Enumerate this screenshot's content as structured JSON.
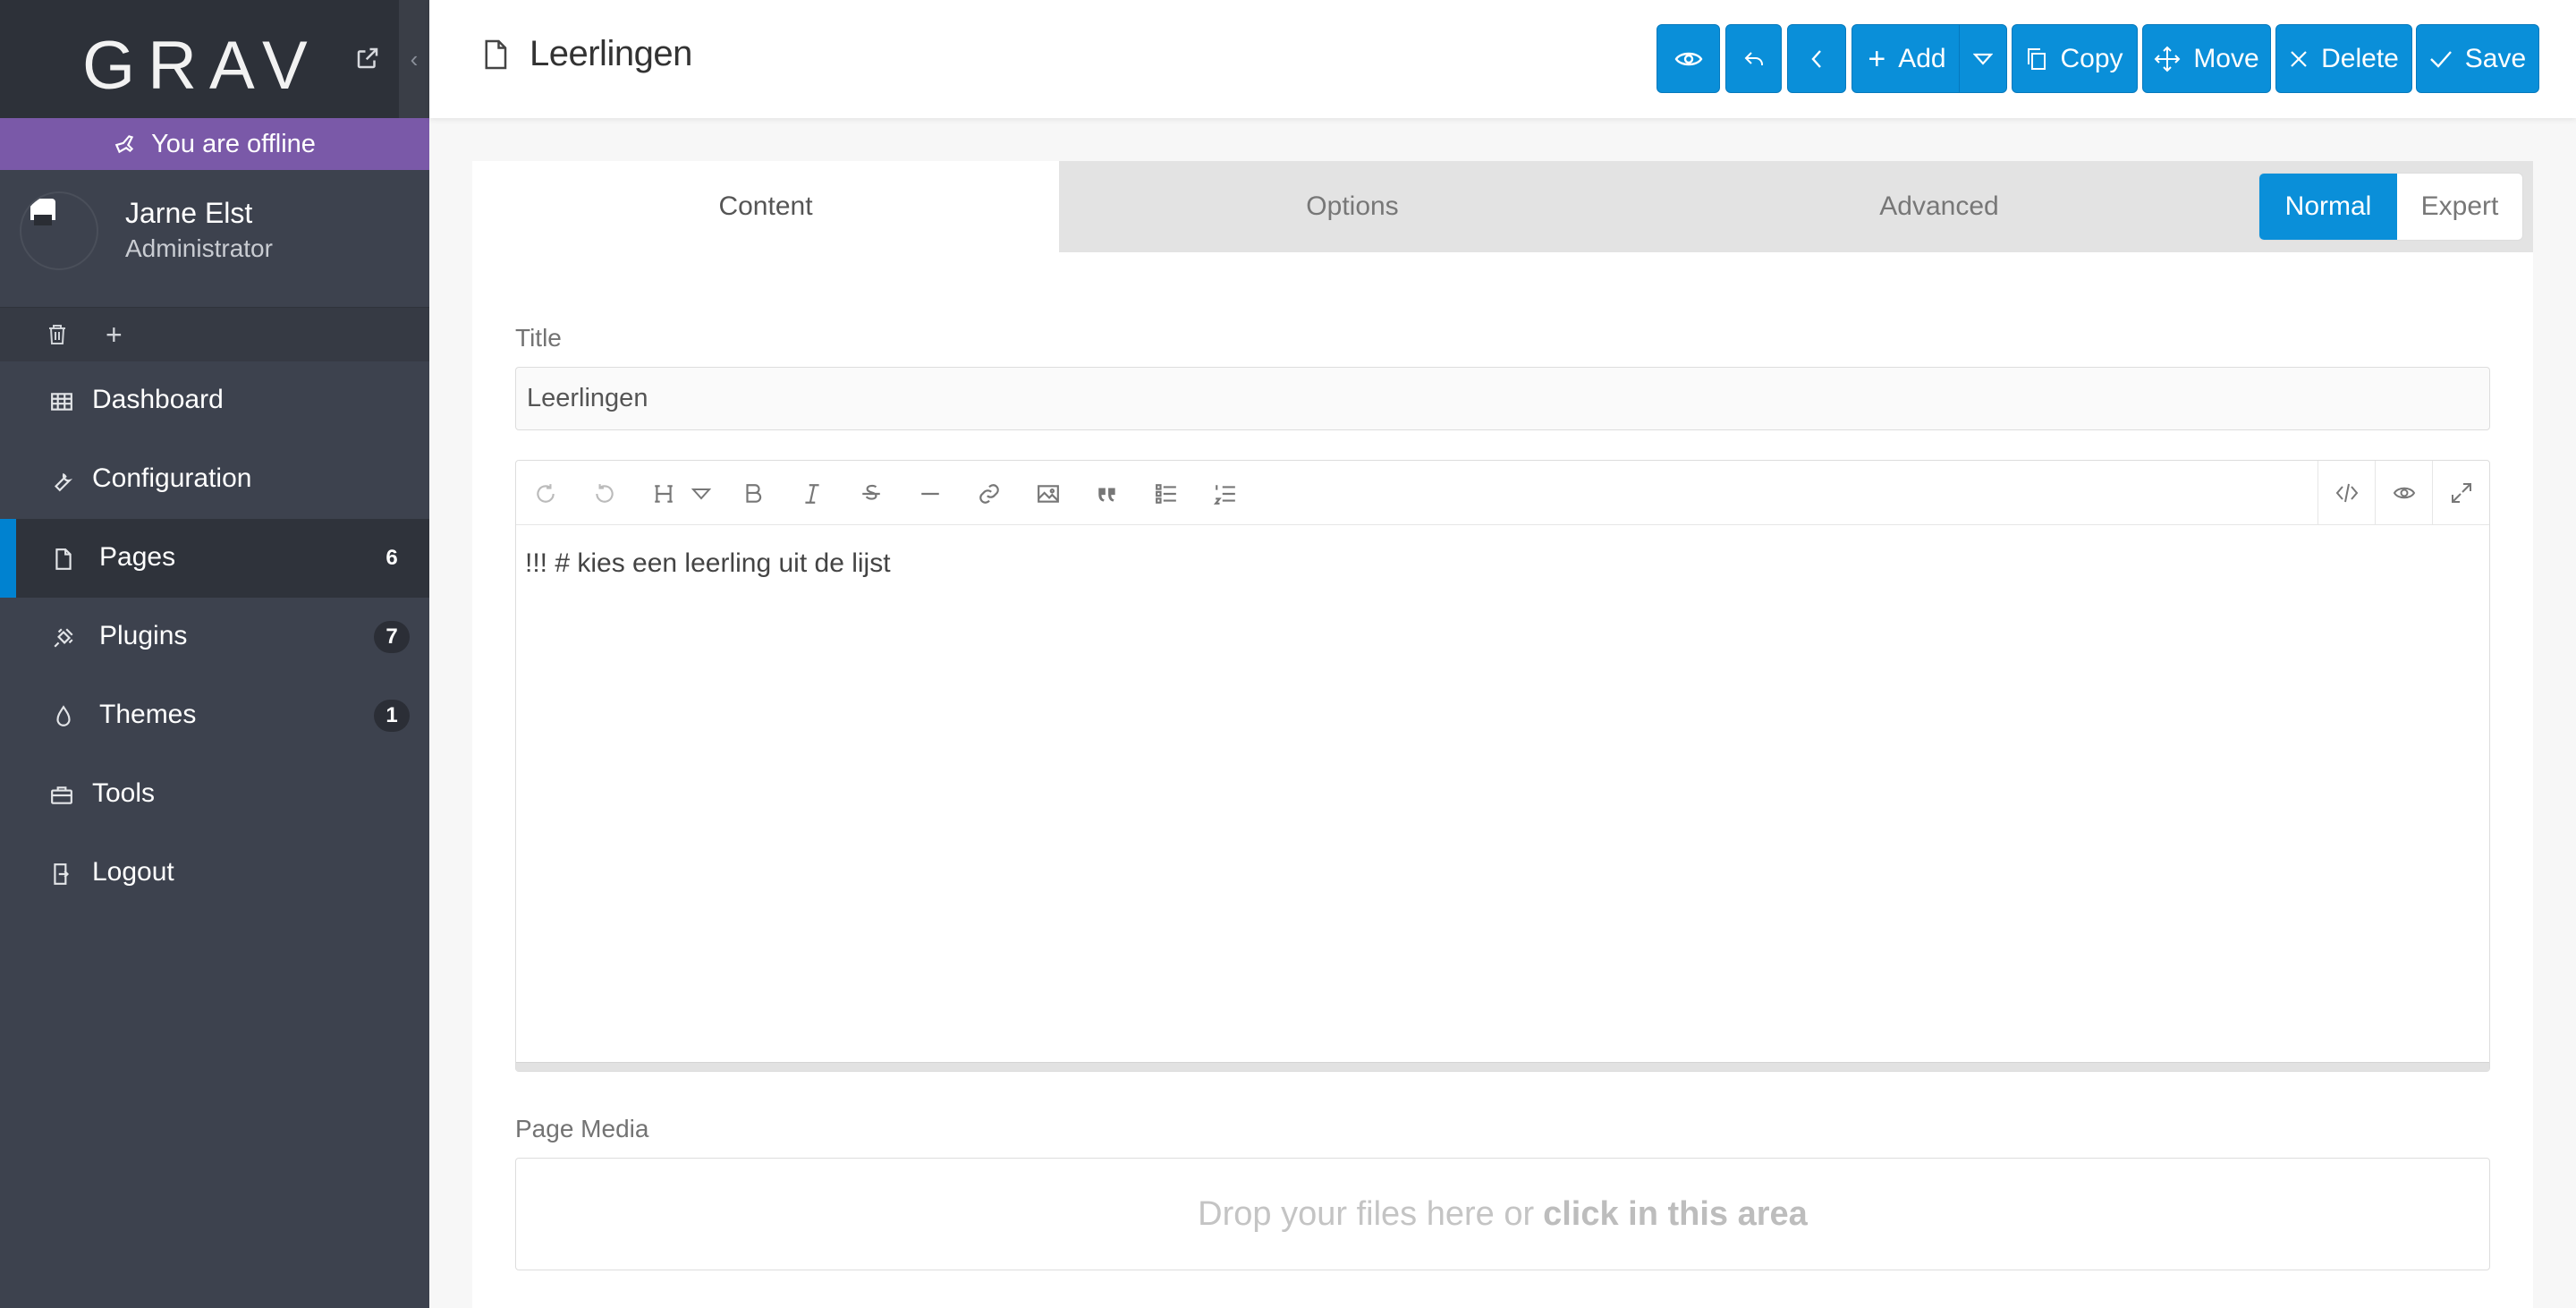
{
  "app": {
    "logo_text": "GRAV"
  },
  "status": {
    "offline_text": "You are offline"
  },
  "user": {
    "name": "Jarne Elst",
    "role": "Administrator"
  },
  "sidebar": {
    "items": [
      {
        "label": "Dashboard",
        "icon": "dashboard-grid-icon"
      },
      {
        "label": "Configuration",
        "icon": "wrench-icon"
      },
      {
        "label": "Pages",
        "icon": "file-icon",
        "count": "6",
        "active": true
      },
      {
        "label": "Plugins",
        "icon": "plug-icon",
        "count": "7"
      },
      {
        "label": "Themes",
        "icon": "drop-icon",
        "count": "1"
      },
      {
        "label": "Tools",
        "icon": "briefcase-icon"
      },
      {
        "label": "Logout",
        "icon": "sign-out-icon"
      }
    ]
  },
  "header": {
    "page_title": "Leerlingen"
  },
  "toolbar": {
    "add_label": "Add",
    "copy_label": "Copy",
    "move_label": "Move",
    "delete_label": "Delete",
    "save_label": "Save"
  },
  "tabs": [
    {
      "label": "Content",
      "active": true
    },
    {
      "label": "Options"
    },
    {
      "label": "Advanced"
    }
  ],
  "mode": {
    "normal_label": "Normal",
    "expert_label": "Expert",
    "selected": "Normal"
  },
  "form": {
    "title_label": "Title",
    "title_value": "Leerlingen",
    "content_value": "!!! # kies een leerling uit de lijst",
    "media_label": "Page Media",
    "dropzone_text": "Drop your files here or",
    "dropzone_bold": "click in this area"
  },
  "colors": {
    "sidebar_bg": "#3d424e",
    "offline_bar": "#7a59a8",
    "accent": "#0a8fd9"
  }
}
